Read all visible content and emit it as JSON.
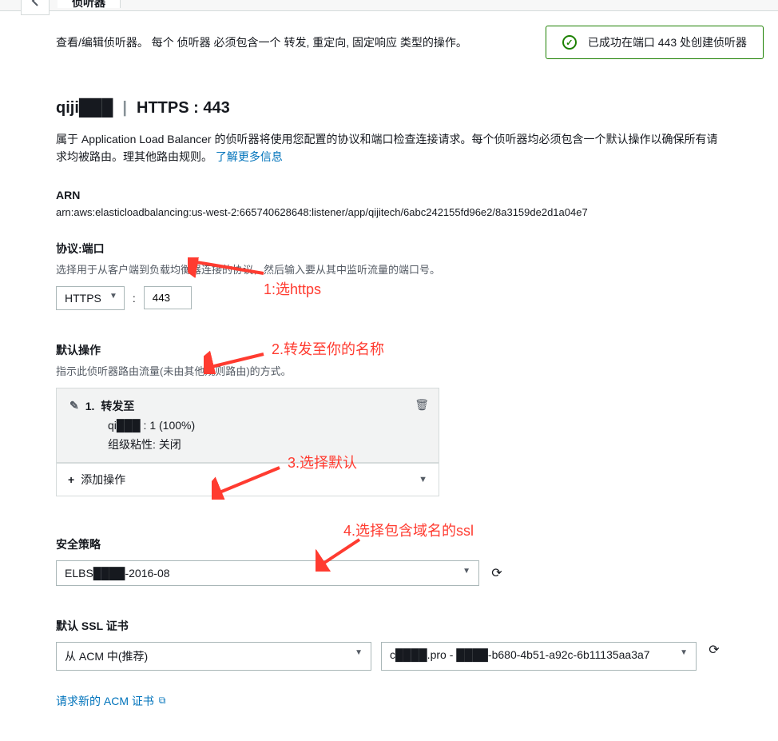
{
  "tab": "侦听器",
  "desc": "查看/编辑侦听器。 每个 侦听器 必须包含一个 转发, 重定向, 固定响应 类型的操作。",
  "success": "已成功在端口 443 处创建侦听器",
  "title": {
    "name": "qiji███",
    "protocol": "HTTPS : 443"
  },
  "intro": "属于 Application Load Balancer 的侦听器将使用您配置的协议和端口检查连接请求。每个侦听器均必须包含一个默认操作以确保所有请求均被路由。理其他路由规则。",
  "learn_more": "了解更多信息",
  "arn": {
    "label": "ARN",
    "value": "arn:aws:elasticloadbalancing:us-west-2:665740628648:listener/app/qijitech/6abc242155fd96e2/8a3159de2d1a04e7"
  },
  "protocol": {
    "label": "协议:端口",
    "sub": "选择用于从客户端到负载均衡器连接的协议，然后输入要从其中监听流量的端口号。",
    "select": "HTTPS",
    "port": "443"
  },
  "annotations": {
    "a1": "1:选https",
    "a2": "2.转发至你的名称",
    "a3": "3.选择默认",
    "a4": "4.选择包含域名的ssl"
  },
  "default_action": {
    "label": "默认操作",
    "sub": "指示此侦听器路由流量(未由其他规则路由)的方式。",
    "index": "1.",
    "forward": "转发至",
    "target": "qi███ : 1 (100%)",
    "sticky": "组级粘性: 关闭",
    "add": "添加操作"
  },
  "security_policy": {
    "label": "安全策略",
    "value": "ELBS████-2016-08"
  },
  "ssl": {
    "label": "默认 SSL 证书",
    "source": "从 ACM 中(推荐)",
    "cert": "c████.pro - ████-b680-4b51-a92c-6b11135aa3a7"
  },
  "acm_link": "请求新的 ACM 证书"
}
